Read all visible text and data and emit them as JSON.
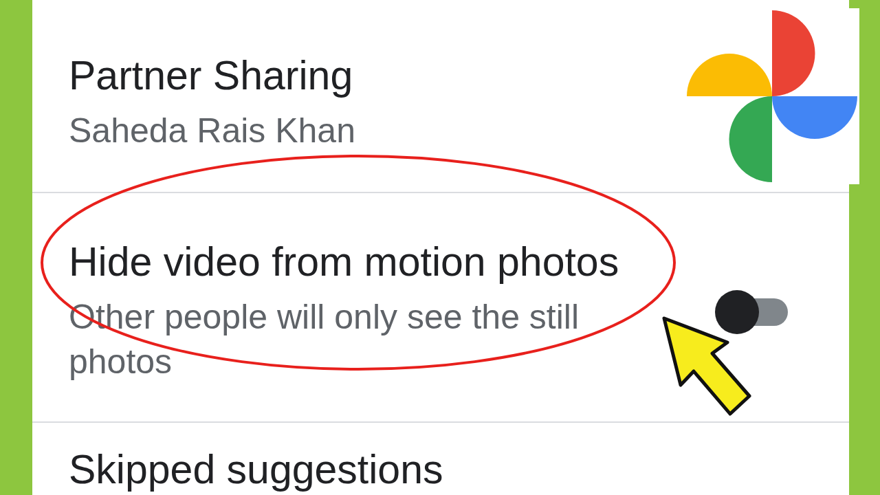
{
  "settings": [
    {
      "kind": "plain",
      "title": "Partner Sharing",
      "subtitle": "Saheda Rais Khan"
    },
    {
      "kind": "toggle",
      "title": "Hide video from motion photos",
      "subtitle": "Other people will only see the still photos",
      "on": false
    },
    {
      "kind": "plain",
      "title": "Skipped suggestions"
    }
  ]
}
